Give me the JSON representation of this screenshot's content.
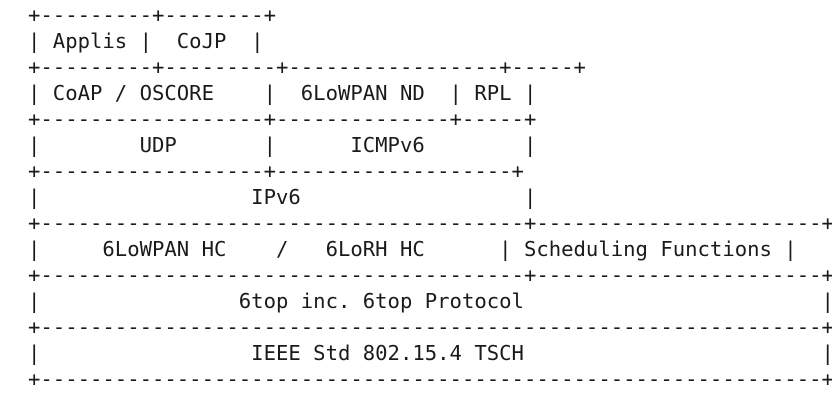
{
  "diagram": {
    "lines": [
      "+---------+--------+",
      "| Applis |  CoJP  |",
      "+---------+---------+-----------------+-----+",
      "| CoAP / OSCORE    |  6LoWPAN ND  | RPL |",
      "+------------------+--------------+-----+",
      "|        UDP       |      ICMPv6        |",
      "+------------------+-------------------+",
      "|                 IPv6                  |",
      "+---------------------------------------+-----------------------+",
      "|     6LoWPAN HC    /   6LoRH HC      | Scheduling Functions |",
      "+---------------------------------------+-----------------------+",
      "|                6top inc. 6top Protocol                        |",
      "+---------------------------------------------------------------+",
      "|                 IEEE Std 802.15.4 TSCH                        |",
      "+---------------------------------------------------------------+"
    ]
  }
}
